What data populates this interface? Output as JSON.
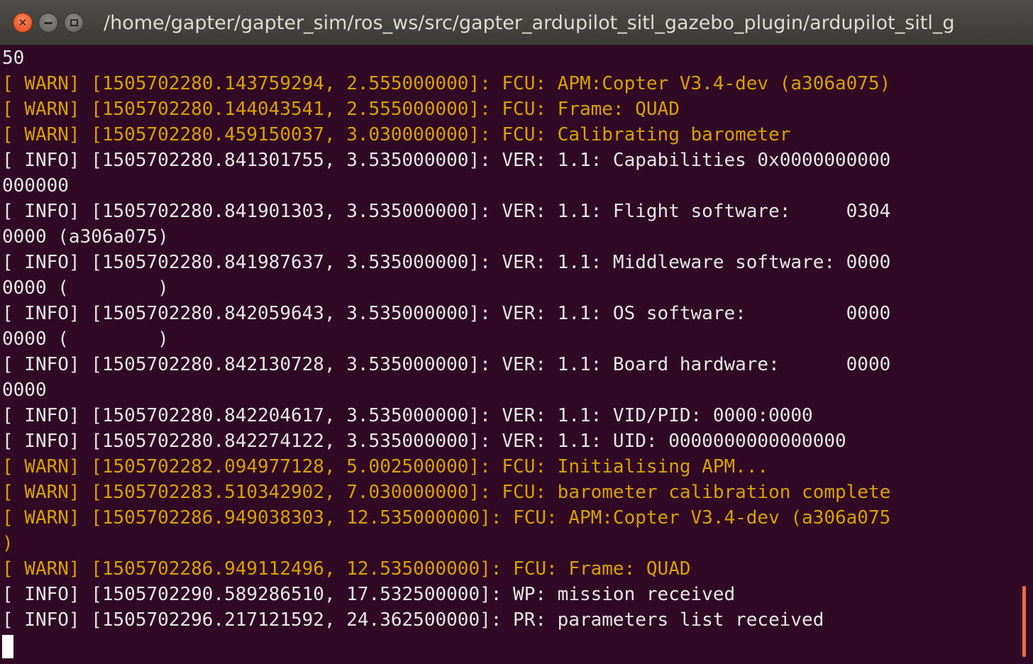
{
  "window": {
    "title": "/home/gapter/gapter_sim/ros_ws/src/gapter_ardupilot_sitl_gazebo_plugin/ardupilot_sitl_g"
  },
  "colors": {
    "background": "#300a24",
    "text": "#e6e6e6",
    "warn": "#d9a000",
    "close_button": "#df4a16",
    "scrollbar": "#e86b4a"
  },
  "icons": {
    "close": "close-icon",
    "minimize": "minimize-icon",
    "maximize": "maximize-icon"
  },
  "terminal": {
    "lines": [
      {
        "level": "plain",
        "text": "50"
      },
      {
        "level": "warn",
        "text": "[ WARN] [1505702280.143759294, 2.555000000]: FCU: APM:Copter V3.4-dev (a306a075)"
      },
      {
        "level": "warn",
        "text": "[ WARN] [1505702280.144043541, 2.555000000]: FCU: Frame: QUAD"
      },
      {
        "level": "warn",
        "text": "[ WARN] [1505702280.459150037, 3.030000000]: FCU: Calibrating barometer"
      },
      {
        "level": "info",
        "text": "[ INFO] [1505702280.841301755, 3.535000000]: VER: 1.1: Capabilities 0x0000000000"
      },
      {
        "level": "info",
        "text": "000000"
      },
      {
        "level": "info",
        "text": "[ INFO] [1505702280.841901303, 3.535000000]: VER: 1.1: Flight software:     0304"
      },
      {
        "level": "info",
        "text": "0000 (a306a075)"
      },
      {
        "level": "info",
        "text": "[ INFO] [1505702280.841987637, 3.535000000]: VER: 1.1: Middleware software: 0000"
      },
      {
        "level": "info",
        "text": "0000 (        )"
      },
      {
        "level": "info",
        "text": "[ INFO] [1505702280.842059643, 3.535000000]: VER: 1.1: OS software:         0000"
      },
      {
        "level": "info",
        "text": "0000 (        )"
      },
      {
        "level": "info",
        "text": "[ INFO] [1505702280.842130728, 3.535000000]: VER: 1.1: Board hardware:      0000"
      },
      {
        "level": "info",
        "text": "0000"
      },
      {
        "level": "info",
        "text": "[ INFO] [1505702280.842204617, 3.535000000]: VER: 1.1: VID/PID: 0000:0000"
      },
      {
        "level": "info",
        "text": "[ INFO] [1505702280.842274122, 3.535000000]: VER: 1.1: UID: 0000000000000000"
      },
      {
        "level": "warn",
        "text": "[ WARN] [1505702282.094977128, 5.002500000]: FCU: Initialising APM..."
      },
      {
        "level": "warn",
        "text": "[ WARN] [1505702283.510342902, 7.030000000]: FCU: barometer calibration complete"
      },
      {
        "level": "warn",
        "text": "[ WARN] [1505702286.949038303, 12.535000000]: FCU: APM:Copter V3.4-dev (a306a075"
      },
      {
        "level": "warn",
        "text": ")"
      },
      {
        "level": "warn",
        "text": "[ WARN] [1505702286.949112496, 12.535000000]: FCU: Frame: QUAD"
      },
      {
        "level": "info",
        "text": "[ INFO] [1505702290.589286510, 17.532500000]: WP: mission received"
      },
      {
        "level": "info",
        "text": "[ INFO] [1505702296.217121592, 24.362500000]: PR: parameters list received"
      }
    ]
  }
}
